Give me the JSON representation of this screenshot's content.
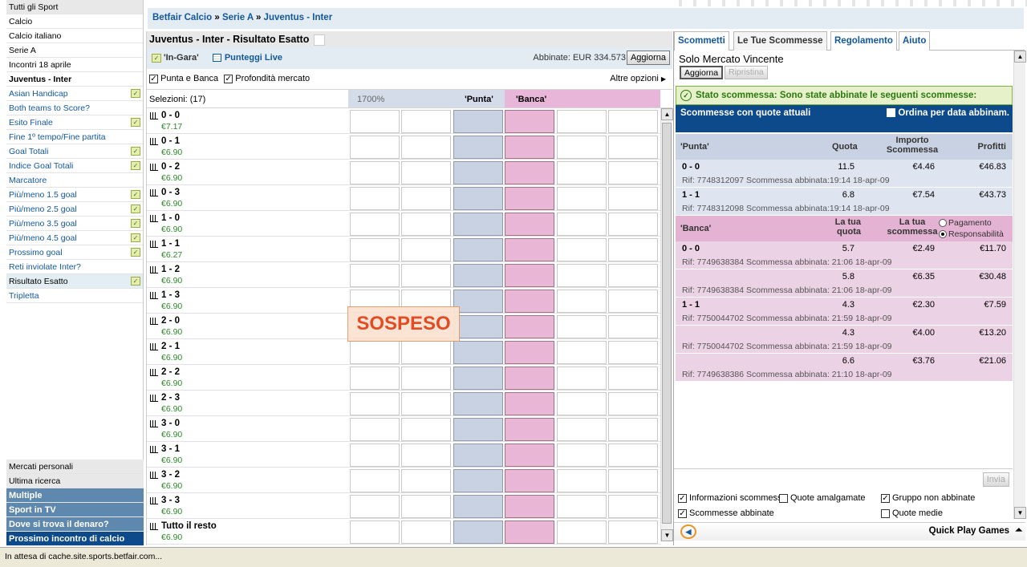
{
  "sidebar": {
    "items": [
      {
        "label": "Tutti gli Sport",
        "style": "grey",
        "check": false
      },
      {
        "label": "Calcio",
        "style": "plain",
        "check": false
      },
      {
        "label": "Calcio italiano",
        "style": "plain",
        "check": false
      },
      {
        "label": "Serie A",
        "style": "plain",
        "check": false
      },
      {
        "label": "Incontri 18 aprile",
        "style": "plain",
        "check": false
      },
      {
        "label": "Juventus - Inter",
        "style": "bold",
        "check": false
      },
      {
        "label": "Asian Handicap",
        "style": "link",
        "check": true
      },
      {
        "label": "Both teams to Score?",
        "style": "link",
        "check": false
      },
      {
        "label": "Esito Finale",
        "style": "link",
        "check": true
      },
      {
        "label": "Fine 1º tempo/Fine partita",
        "style": "link",
        "check": false
      },
      {
        "label": "Goal Totali",
        "style": "link",
        "check": true
      },
      {
        "label": "Indice Goal Totali",
        "style": "link",
        "check": true
      },
      {
        "label": "Marcatore",
        "style": "link",
        "check": false
      },
      {
        "label": "Più/meno 1.5 goal",
        "style": "link",
        "check": true
      },
      {
        "label": "Più/meno 2.5 goal",
        "style": "link",
        "check": true
      },
      {
        "label": "Più/meno 3.5 goal",
        "style": "link",
        "check": true
      },
      {
        "label": "Più/meno 4.5 goal",
        "style": "link",
        "check": true
      },
      {
        "label": "Prossimo goal",
        "style": "link",
        "check": true
      },
      {
        "label": "Reti inviolate Inter?",
        "style": "link",
        "check": false
      },
      {
        "label": "Risultato Esatto",
        "style": "selected",
        "check": true
      },
      {
        "label": "Tripletta",
        "style": "link",
        "check": false
      }
    ],
    "bottom": [
      {
        "label": "Mercati personali",
        "style": "grey"
      },
      {
        "label": "Ultima ricerca",
        "style": "grey"
      },
      {
        "label": "Multiple",
        "style": "blue"
      },
      {
        "label": "Sport in TV",
        "style": "blue"
      },
      {
        "label": "Dove si trova il denaro?",
        "style": "blue"
      },
      {
        "label": "Prossimo incontro di calcio",
        "style": "dark"
      }
    ]
  },
  "breadcrumb": {
    "part1": "Betfair Calcio",
    "part2": "Serie A",
    "part3": "Juventus - Inter",
    "sep": "»"
  },
  "market": {
    "title": "Juventus - Inter - Risultato Esatto",
    "in_play": "'In-Gara'",
    "live_scores": "Punteggi Live",
    "matched": "Abbinate: EUR 334.573",
    "refresh": "Aggiorna",
    "option_back_lay": "Punta e Banca",
    "option_depth": "Profondità mercato",
    "more_options": "Altre opzioni",
    "selections_label": "Selezioni:  (17)",
    "book_pct": "1700%",
    "back_header": "'Punta'",
    "lay_header": "'Banca'",
    "suspended": "SOSPESO",
    "rows": [
      {
        "name": "0 - 0",
        "pl": "€7.17"
      },
      {
        "name": "0 - 1",
        "pl": "€6.90"
      },
      {
        "name": "0 - 2",
        "pl": "€6.90"
      },
      {
        "name": "0 - 3",
        "pl": "€6.90"
      },
      {
        "name": "1 - 0",
        "pl": "€6.90"
      },
      {
        "name": "1 - 1",
        "pl": "€6.27"
      },
      {
        "name": "1 - 2",
        "pl": "€6.90"
      },
      {
        "name": "1 - 3",
        "pl": "€6.90"
      },
      {
        "name": "2 - 0",
        "pl": "€6.90"
      },
      {
        "name": "2 - 1",
        "pl": "€6.90"
      },
      {
        "name": "2 - 2",
        "pl": "€6.90"
      },
      {
        "name": "2 - 3",
        "pl": "€6.90"
      },
      {
        "name": "3 - 0",
        "pl": "€6.90"
      },
      {
        "name": "3 - 1",
        "pl": "€6.90"
      },
      {
        "name": "3 - 2",
        "pl": "€6.90"
      },
      {
        "name": "3 - 3",
        "pl": "€6.90"
      },
      {
        "name": "Tutto il resto",
        "pl": "€6.90"
      }
    ]
  },
  "bets": {
    "tabs": [
      "Scommetti",
      "Le Tue Scommesse",
      "Regolamento",
      "Aiuto"
    ],
    "solo": "Solo Mercato Vincente",
    "refresh": "Aggiorna",
    "reset": "Ripristina",
    "status": "Stato scommessa: Sono state abbinate le seguenti scommesse:",
    "current_odds": "Scommesse con quote attuali",
    "sort_by_date": "Ordina per data abbinam.",
    "back_head": {
      "a": "'Punta'",
      "b": "Quota",
      "c": "Importo Scommessa",
      "d": "Profitti"
    },
    "lay_head": {
      "a": "'Banca'",
      "b": "La tua quota",
      "c": "La tua scommessa",
      "r1": "Pagamento",
      "r2": "Responsabilità"
    },
    "back_rows": [
      {
        "sel": "0 - 0",
        "q": "11.5",
        "imp": "€4.46",
        "pro": "€46.83",
        "ref": "Rif: 7748312097 Scommessa abbinata:19:14 18-apr-09"
      },
      {
        "sel": "1 - 1",
        "q": "6.8",
        "imp": "€7.54",
        "pro": "€43.73",
        "ref": "Rif: 7748312098 Scommessa abbinata:19:14 18-apr-09"
      }
    ],
    "lay_rows": [
      {
        "sel": "0 - 0",
        "q": "5.7",
        "imp": "€2.49",
        "pro": "€11.70",
        "ref": "Rif: 7749638384 Scommessa abbinata: 21:06 18-apr-09"
      },
      {
        "sel": "",
        "q": "5.8",
        "imp": "€6.35",
        "pro": "€30.48",
        "ref": "Rif: 7749638384 Scommessa abbinata: 21:06 18-apr-09"
      },
      {
        "sel": "1 - 1",
        "q": "4.3",
        "imp": "€2.30",
        "pro": "€7.59",
        "ref": "Rif: 7750044702 Scommessa abbinata: 21:59 18-apr-09"
      },
      {
        "sel": "",
        "q": "4.3",
        "imp": "€4.00",
        "pro": "€13.20",
        "ref": "Rif: 7750044702 Scommessa abbinata: 21:59 18-apr-09"
      },
      {
        "sel": "",
        "q": "6.6",
        "imp": "€3.76",
        "pro": "€21.06",
        "ref": "Rif: 7749638386 Scommessa abbinata: 21:10 18-apr-09"
      }
    ],
    "send": "Invia",
    "opt_info": "Informazioni scommess",
    "opt_merged": "Quote amalgamate",
    "opt_group": "Gruppo non abbinate",
    "opt_matched": "Scommesse abbinate",
    "opt_avg": "Quote medie",
    "quick_play": "Quick Play Games"
  },
  "statusbar": "In attesa di cache.site.sports.betfair.com..."
}
